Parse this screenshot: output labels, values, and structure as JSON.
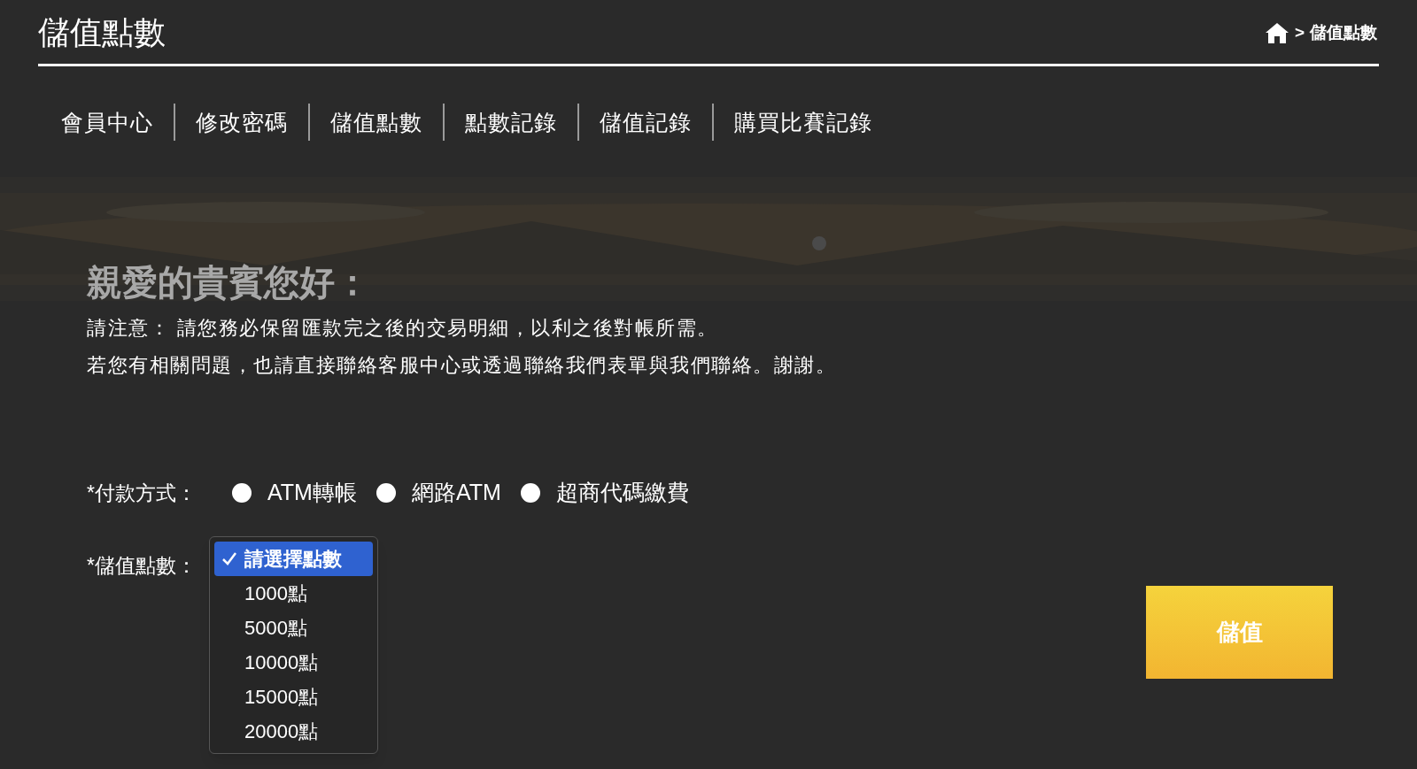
{
  "page_title": "儲值點數",
  "breadcrumb": {
    "separator": ">",
    "current": "儲值點數"
  },
  "tabs": [
    {
      "label": "會員中心"
    },
    {
      "label": "修改密碼"
    },
    {
      "label": "儲值點數"
    },
    {
      "label": "點數記錄"
    },
    {
      "label": "儲值記錄"
    },
    {
      "label": "購買比賽記錄"
    }
  ],
  "greeting": "親愛的貴賓您好：",
  "notices": [
    "請注意： 請您務必保留匯款完之後的交易明細，以利之後對帳所需。",
    "若您有相關問題，也請直接聯絡客服中心或透過聯絡我們表單與我們聯絡。謝謝。"
  ],
  "payment_method": {
    "label": "*付款方式：",
    "options": [
      {
        "label": "ATM轉帳",
        "selected": false
      },
      {
        "label": "網路ATM",
        "selected": false
      },
      {
        "label": "超商代碼繳費",
        "selected": false
      }
    ]
  },
  "points": {
    "label": "*儲值點數：",
    "expanded": true,
    "options": [
      {
        "label": "請選擇點數",
        "selected": true
      },
      {
        "label": "1000點",
        "selected": false
      },
      {
        "label": "5000點",
        "selected": false
      },
      {
        "label": "10000點",
        "selected": false
      },
      {
        "label": "15000點",
        "selected": false
      },
      {
        "label": "20000點",
        "selected": false
      }
    ]
  },
  "submit_button": "儲值"
}
